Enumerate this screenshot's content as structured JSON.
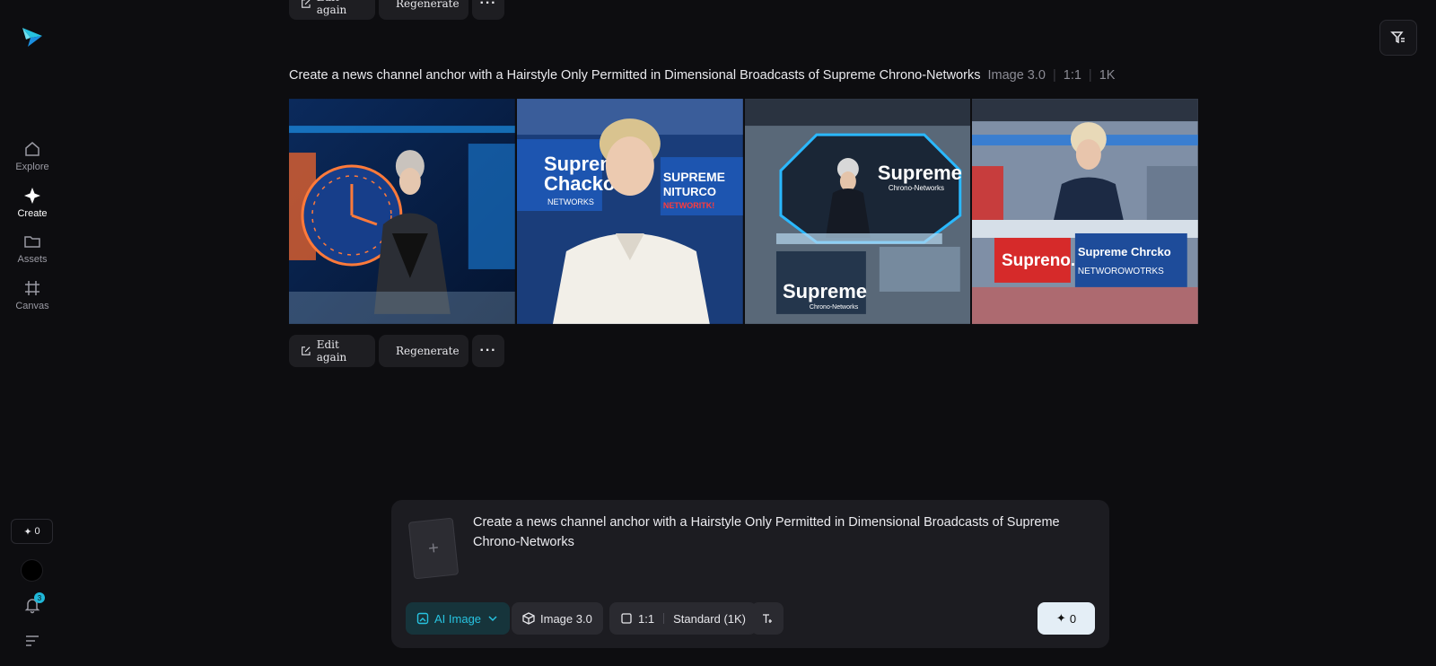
{
  "sidebar": {
    "items": [
      {
        "label": "Explore"
      },
      {
        "label": "Create"
      },
      {
        "label": "Assets"
      },
      {
        "label": "Canvas"
      }
    ],
    "credits": "0",
    "notifications": "3"
  },
  "actions": {
    "edit_again": "Edit again",
    "regenerate": "Regenerate",
    "more": "···"
  },
  "generation": {
    "prompt": "Create a news channel anchor with a Hairstyle Only Permitted in Dimensional Broadcasts of Supreme Chrono-Networks",
    "model": "Image 3.0",
    "ratio": "1:1",
    "resolution": "1K"
  },
  "images": {
    "tile2_text_a": "Supreme",
    "tile2_text_b": "Chacko",
    "tile2_text_c": "NETWORKS",
    "tile2_text_d": "SUPREME",
    "tile2_text_e": "NITURCO",
    "tile2_text_f": "NETWORITK!",
    "tile3_text_a": "Supreme",
    "tile3_text_b": "Chrono-Networks",
    "tile3_text_c": "Supreme",
    "tile3_text_d": "Chrono-Networks",
    "tile4_text_a": "Supreno.",
    "tile4_text_b": "Supreme Chrcko",
    "tile4_text_c": "NETWOROWOTRKS"
  },
  "composer": {
    "prompt_text": "Create a news channel anchor with a Hairstyle Only Permitted in Dimensional Broadcasts of Supreme Chrono-Networks",
    "mode": "AI Image",
    "model": "Image 3.0",
    "ratio": "1:1",
    "quality": "Standard (1K)",
    "generate_cost": "0"
  },
  "colors": {
    "accent": "#27c3e0",
    "background": "#0d0d10",
    "panel": "#1c1c21"
  }
}
